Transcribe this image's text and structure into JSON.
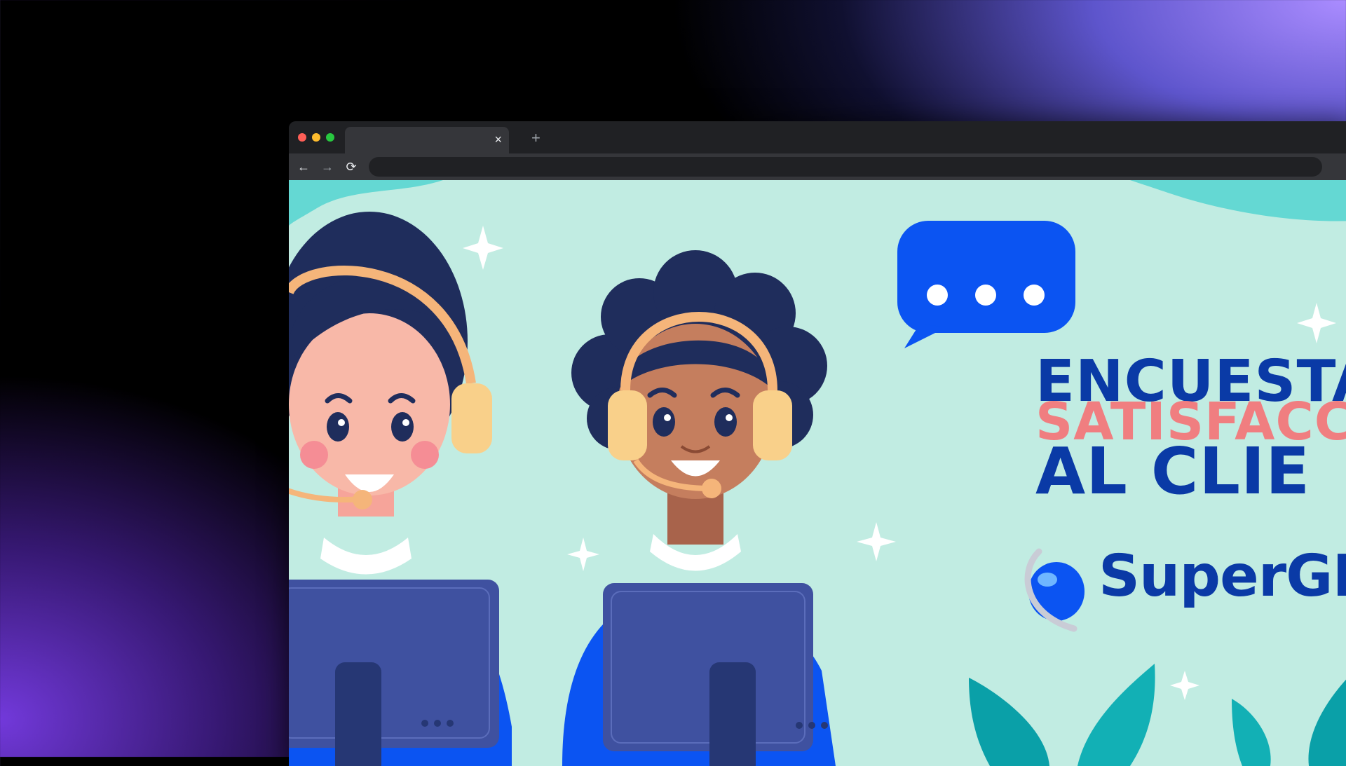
{
  "browser": {
    "tab": {
      "title": "",
      "close_icon": "×"
    },
    "new_tab_icon": "+",
    "toolbar": {
      "back_icon": "←",
      "forward_icon": "→",
      "reload_icon": "⟳",
      "address": "",
      "menu_icon": "⋮"
    }
  },
  "banner": {
    "title_line1": "ENCUESTA",
    "title_line2": "SATISFACC",
    "title_line3": "AL CLIE",
    "brand": "SuperGI"
  },
  "colors": {
    "banner_bg": "#c1ece2",
    "title_blue": "#0a3aa6",
    "title_pink": "#f07e80",
    "bubble_blue": "#0b54f2"
  }
}
